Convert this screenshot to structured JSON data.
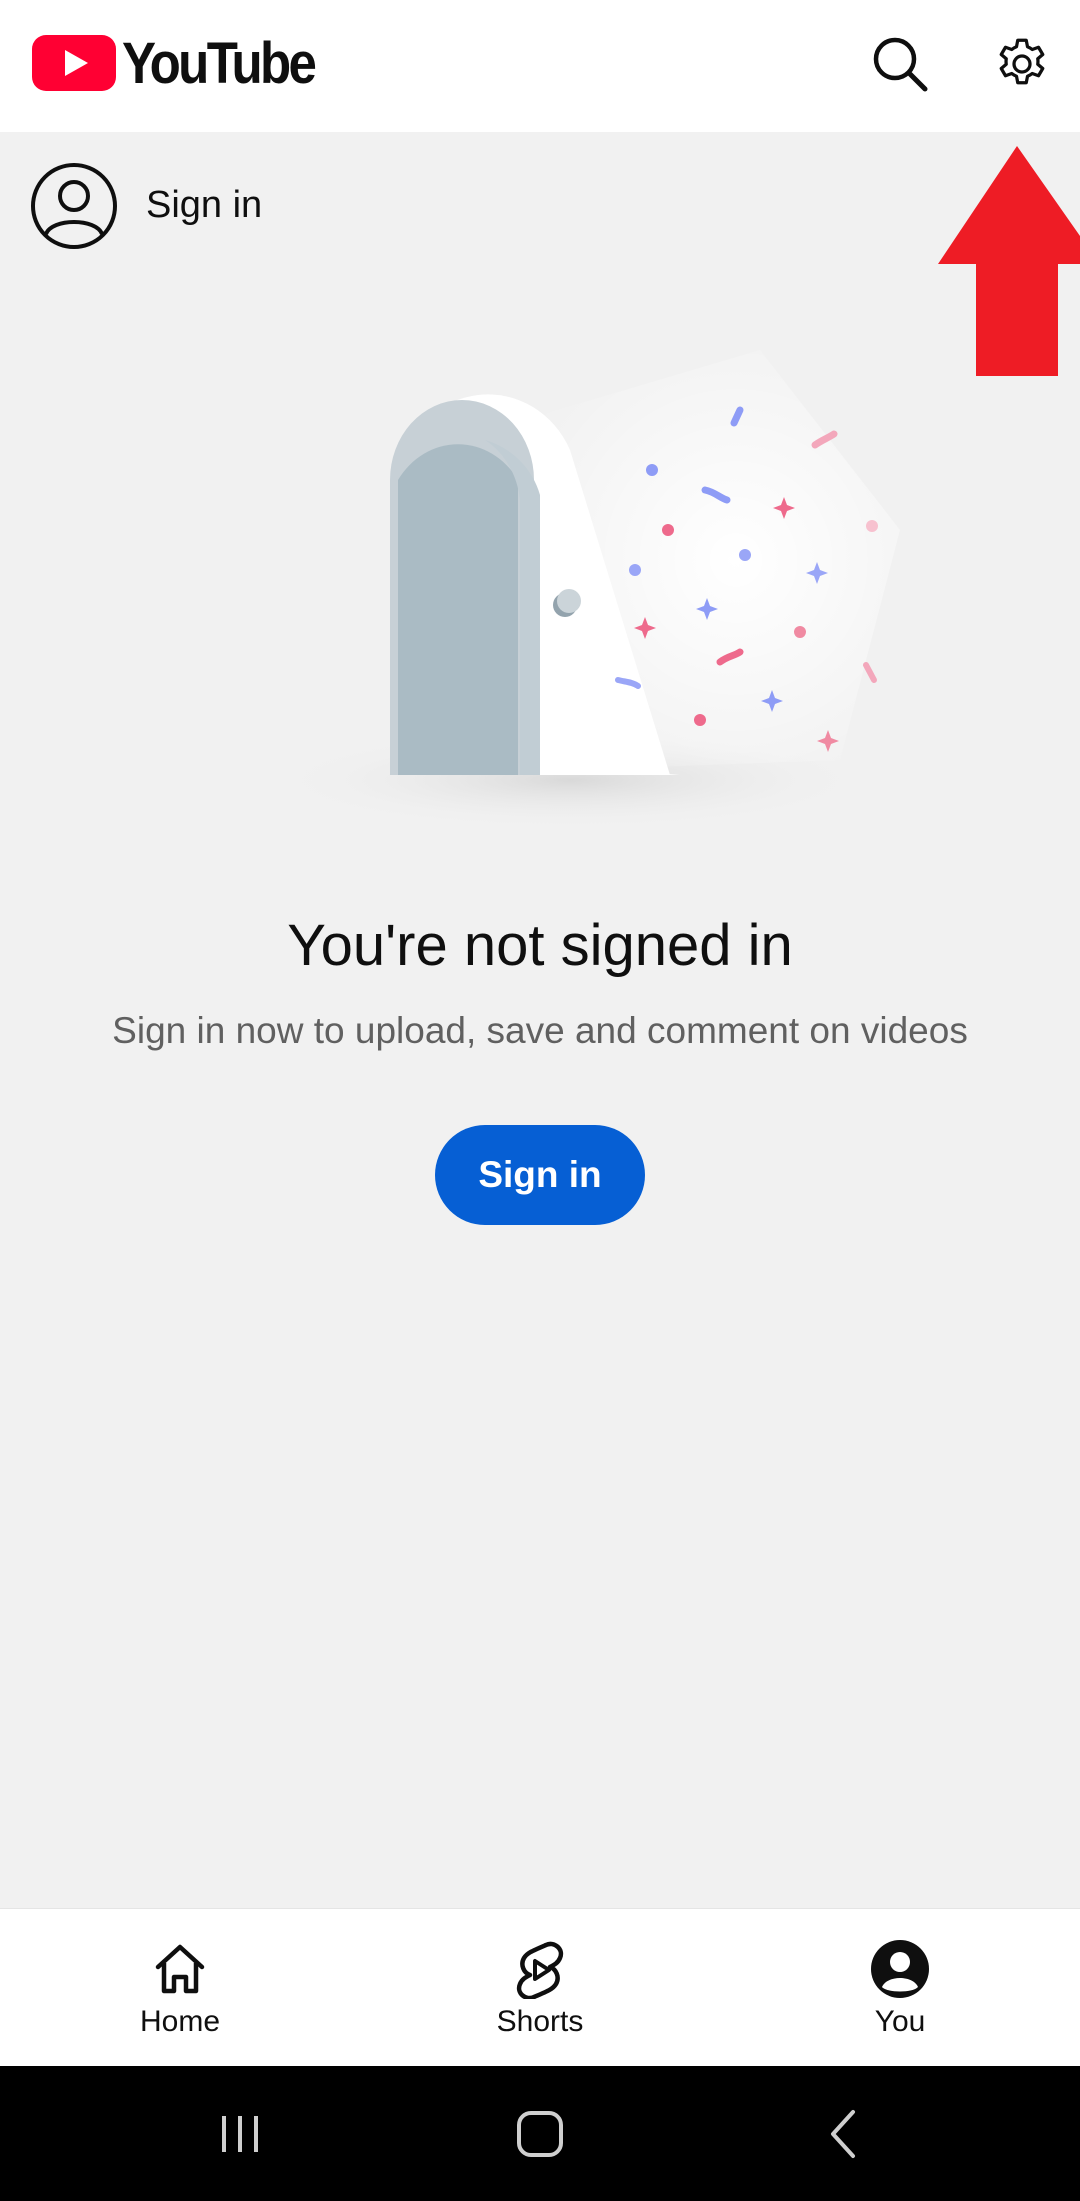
{
  "header": {
    "logo_text": "YouTube",
    "search_icon": "search-icon",
    "settings_icon": "gear-icon"
  },
  "signin_row": {
    "label": "Sign in",
    "icon": "account-circle-icon"
  },
  "empty_state": {
    "title": "You're not signed in",
    "subtitle": "Sign in now to upload, save and comment on videos",
    "button_label": "Sign in"
  },
  "annotation": {
    "arrow_color": "#ee1c25"
  },
  "bottom_nav": {
    "items": [
      {
        "label": "Home",
        "icon": "home-icon"
      },
      {
        "label": "Shorts",
        "icon": "shorts-icon"
      },
      {
        "label": "You",
        "icon": "account-filled-icon",
        "selected": true
      }
    ]
  },
  "colors": {
    "brand_red": "#ff0033",
    "primary_blue": "#065fd4",
    "background": "#f1f1f1"
  }
}
